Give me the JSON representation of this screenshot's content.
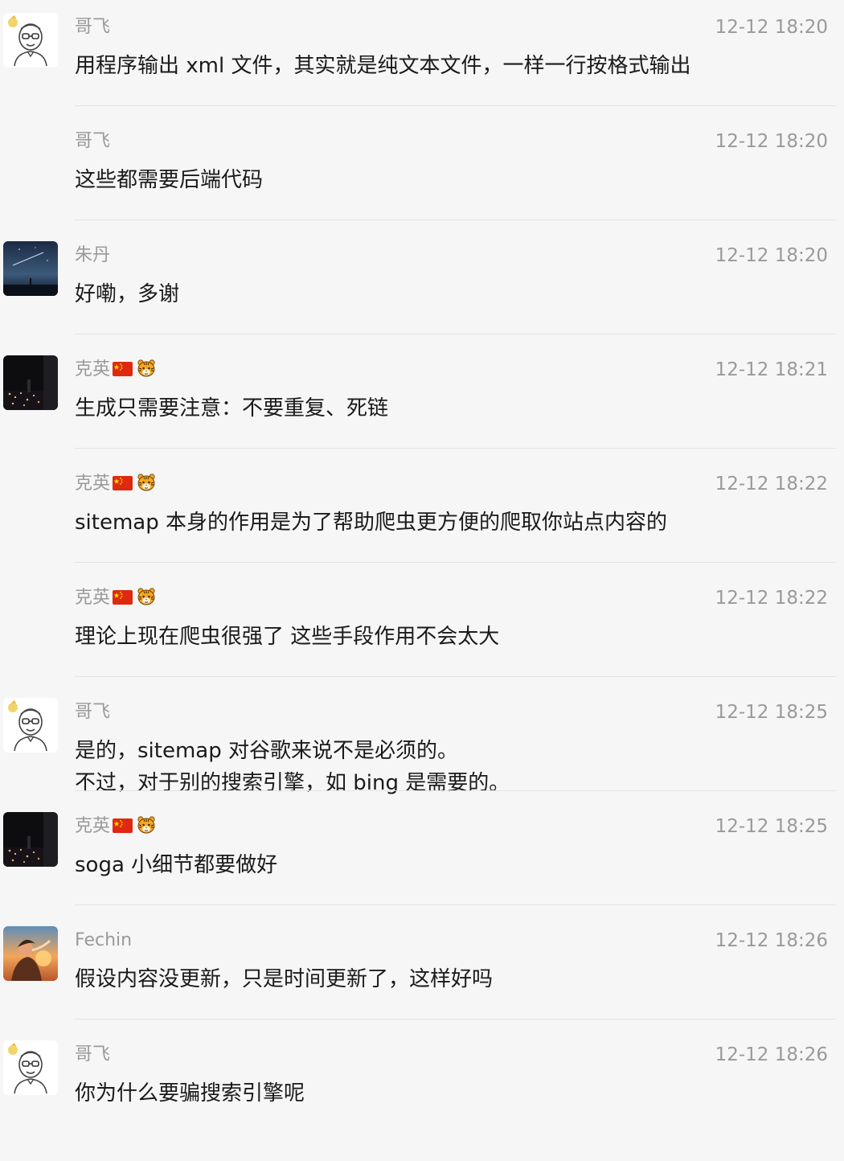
{
  "messages": [
    {
      "name": "哥飞",
      "time": "12-12 18:20",
      "lines": [
        "用程序输出 xml 文件，其实就是纯文本文件，一样一行按格式输出"
      ],
      "avatar": "cartoon-man-glasses-avatar",
      "show_avatar": true,
      "badges": []
    },
    {
      "name": "哥飞",
      "time": "12-12 18:20",
      "lines": [
        "这些都需要后端代码"
      ],
      "avatar": "cartoon-man-glasses-avatar",
      "show_avatar": false,
      "badges": []
    },
    {
      "name": "朱丹",
      "time": "12-12 18:20",
      "lines": [
        "好嘞，多谢"
      ],
      "avatar": "night-sky-meteor-avatar",
      "show_avatar": true,
      "badges": []
    },
    {
      "name": "克英",
      "time": "12-12 18:21",
      "lines": [
        "生成只需要注意：不要重复、死链"
      ],
      "avatar": "night-city-lights-avatar",
      "show_avatar": true,
      "badges": [
        "china-flag-icon",
        "tiger-face-icon"
      ]
    },
    {
      "name": "克英",
      "time": "12-12 18:22",
      "lines": [
        "sitemap 本身的作用是为了帮助爬虫更方便的爬取你站点内容的"
      ],
      "avatar": "night-city-lights-avatar",
      "show_avatar": false,
      "badges": [
        "china-flag-icon",
        "tiger-face-icon"
      ]
    },
    {
      "name": "克英",
      "time": "12-12 18:22",
      "lines": [
        "理论上现在爬虫很强了  这些手段作用不会太大"
      ],
      "avatar": "night-city-lights-avatar",
      "show_avatar": false,
      "badges": [
        "china-flag-icon",
        "tiger-face-icon"
      ]
    },
    {
      "name": "哥飞",
      "time": "12-12 18:25",
      "lines": [
        "是的，sitemap 对谷歌来说不是必须的。",
        "不过，对于别的搜索引擎，如 bing 是需要的。"
      ],
      "avatar": "cartoon-man-glasses-avatar",
      "show_avatar": true,
      "badges": []
    },
    {
      "name": "克英",
      "time": "12-12 18:25",
      "lines": [
        "soga 小细节都要做好"
      ],
      "avatar": "night-city-lights-avatar",
      "show_avatar": true,
      "badges": [
        "china-flag-icon",
        "tiger-face-icon"
      ]
    },
    {
      "name": "Fechin",
      "time": "12-12 18:26",
      "lines": [
        "假设内容没更新，只是时间更新了，这样好吗"
      ],
      "avatar": "sunset-portrait-avatar",
      "show_avatar": true,
      "badges": []
    },
    {
      "name": "哥飞",
      "time": "12-12 18:26",
      "lines": [
        "你为什么要骗搜索引擎呢"
      ],
      "avatar": "cartoon-man-glasses-avatar",
      "show_avatar": true,
      "badges": []
    }
  ]
}
